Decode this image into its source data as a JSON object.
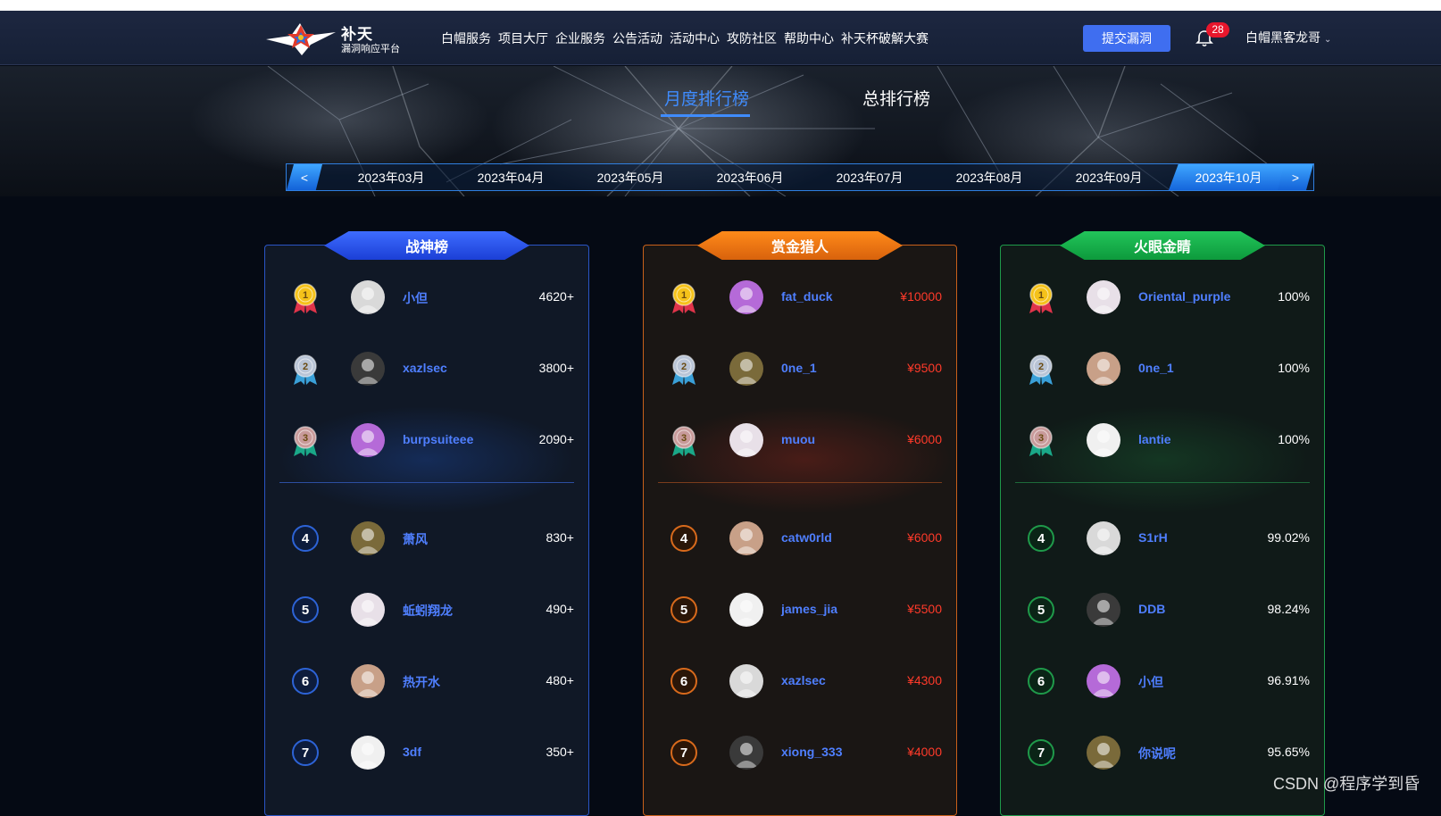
{
  "nav": {
    "logo_title": "补天",
    "logo_subtitle": "漏洞响应平台",
    "menu": [
      "白帽服务",
      "项目大厅",
      "企业服务",
      "公告活动",
      "活动中心",
      "攻防社区",
      "帮助中心",
      "补天杯破解大赛"
    ],
    "submit_label": "提交漏洞",
    "notification_count": "28",
    "username": "白帽黑客龙哥",
    "icons": {
      "bell": "bell-icon",
      "chevron": "chevron-down-icon"
    }
  },
  "tabs": {
    "monthly": "月度排行榜",
    "total": "总排行榜",
    "active": "monthly"
  },
  "months": {
    "prev_label": "<",
    "next_label": ">",
    "items": [
      "2023年03月",
      "2023年04月",
      "2023年05月",
      "2023年06月",
      "2023年07月",
      "2023年08月",
      "2023年09月",
      "2023年10月"
    ],
    "active": "2023年10月"
  },
  "boards": [
    {
      "title": "战神榜",
      "theme": "#2e5cf0",
      "rows": [
        {
          "rank": "1",
          "name": "小但",
          "value": "4620+"
        },
        {
          "rank": "2",
          "name": "xazlsec",
          "value": "3800+"
        },
        {
          "rank": "3",
          "name": "burpsuiteee",
          "value": "2090+"
        },
        {
          "rank": "4",
          "name": "萧风",
          "value": "830+"
        },
        {
          "rank": "5",
          "name": "蚯蚓翔龙",
          "value": "490+"
        },
        {
          "rank": "6",
          "name": "热开水",
          "value": "480+"
        },
        {
          "rank": "7",
          "name": "3df",
          "value": "350+"
        }
      ]
    },
    {
      "title": "赏金猎人",
      "theme": "#f07a12",
      "rows": [
        {
          "rank": "1",
          "name": "fat_duck",
          "value": "¥10000"
        },
        {
          "rank": "2",
          "name": "0ne_1",
          "value": "¥9500"
        },
        {
          "rank": "3",
          "name": "muou",
          "value": "¥6000"
        },
        {
          "rank": "4",
          "name": "catw0rld",
          "value": "¥6000"
        },
        {
          "rank": "5",
          "name": "james_jia",
          "value": "¥5500"
        },
        {
          "rank": "6",
          "name": "xazlsec",
          "value": "¥4300"
        },
        {
          "rank": "7",
          "name": "xiong_333",
          "value": "¥4000"
        }
      ]
    },
    {
      "title": "火眼金睛",
      "theme": "#18b04c",
      "rows": [
        {
          "rank": "1",
          "name": "Oriental_purple",
          "value": "100%"
        },
        {
          "rank": "2",
          "name": "0ne_1",
          "value": "100%"
        },
        {
          "rank": "3",
          "name": "lantie",
          "value": "100%"
        },
        {
          "rank": "4",
          "name": "S1rH",
          "value": "99.02%"
        },
        {
          "rank": "5",
          "name": "DDB",
          "value": "98.24%"
        },
        {
          "rank": "6",
          "name": "小但",
          "value": "96.91%"
        },
        {
          "rank": "7",
          "name": "你说呢",
          "value": "95.65%"
        }
      ]
    }
  ],
  "watermark": "CSDN @程序学到昏"
}
